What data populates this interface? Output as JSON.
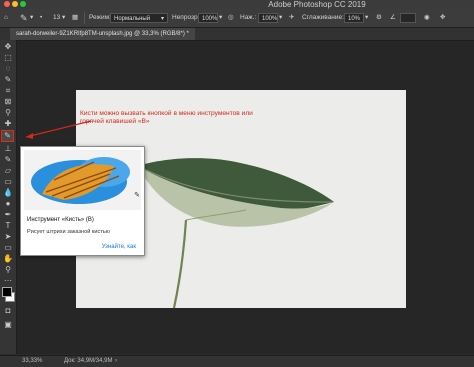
{
  "window": {
    "title": "Adobe Photoshop CC 2019"
  },
  "options_bar": {
    "size_value": "13",
    "mode_label": "Режим:",
    "mode_value": "Нормальный",
    "opacity_label": "Непрозр.:",
    "opacity_value": "100%",
    "press_label": "Наж.:",
    "press_value": "100%",
    "smoothing_label": "Сглаживание:",
    "smoothing_value": "10%"
  },
  "document": {
    "tab_label": "sarah-dorweiler-9Z1KRIfp8TM-unsplash.jpg @ 33,3% (RGB/8*) *"
  },
  "annotation": {
    "text": "Кисти можно вызвать кнопкой в меню инструментов или горячей клавишей «B»"
  },
  "tooltip": {
    "title": "Инструмент «Кисть» (B)",
    "description": "Рисует штрихи заказной кистью",
    "link": "Узнайте, как"
  },
  "status_bar": {
    "zoom": "33,33%",
    "doc_info": "Док: 34,9M/34,9M"
  },
  "colors": {
    "annotation": "#d12a1a",
    "link": "#1a73d9",
    "active_tool": "#e02a1a"
  }
}
